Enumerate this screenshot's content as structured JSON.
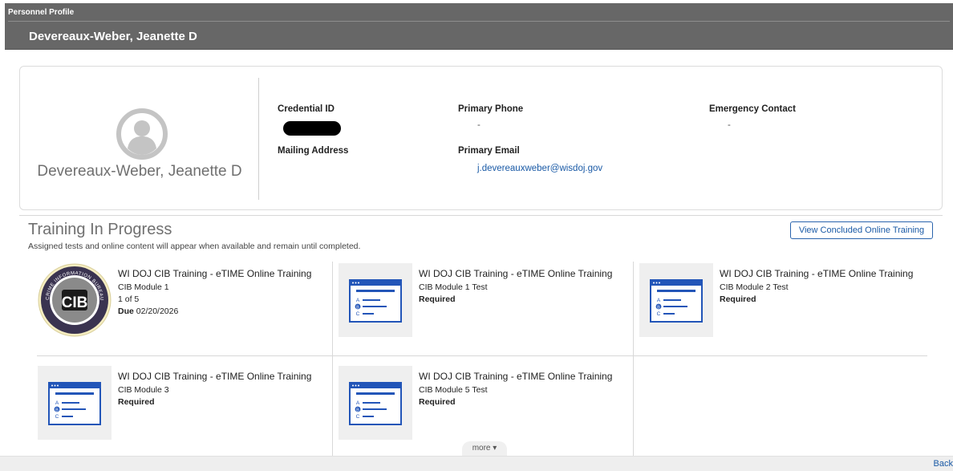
{
  "header": {
    "section_title": "Personnel Profile",
    "person_name": "Devereaux-Weber, Jeanette D"
  },
  "profile": {
    "display_name": "Devereaux-Weber, Jeanette D",
    "credential_id_label": "Credential ID",
    "mailing_address_label": "Mailing Address",
    "primary_phone_label": "Primary Phone",
    "primary_phone_value": "-",
    "primary_email_label": "Primary Email",
    "primary_email_value": "j.devereauxweber@wisdoj.gov",
    "emergency_contact_label": "Emergency Contact",
    "emergency_contact_value": "-"
  },
  "training": {
    "title": "Training In Progress",
    "subtitle": "Assigned tests and online content will appear when available and remain until completed.",
    "view_concluded_label": "View Concluded Online Training",
    "more_label": "more ▾",
    "items": [
      {
        "title": "WI DOJ CIB Training - eTIME Online Training",
        "module": "CIB Module 1",
        "progress": "1 of 5",
        "due_label": "Due",
        "due_date": "02/20/2026",
        "icon": "cib-seal-icon"
      },
      {
        "title": "WI DOJ CIB Training - eTIME Online Training",
        "module": "CIB Module 1 Test",
        "status": "Required",
        "icon": "quiz-window-icon"
      },
      {
        "title": "WI DOJ CIB Training - eTIME Online Training",
        "module": "CIB Module 2 Test",
        "status": "Required",
        "icon": "quiz-window-icon"
      },
      {
        "title": "WI DOJ CIB Training - eTIME Online Training",
        "module": "CIB Module 3",
        "status": "Required",
        "icon": "quiz-window-icon"
      },
      {
        "title": "WI DOJ CIB Training - eTIME Online Training",
        "module": "CIB Module 5 Test",
        "status": "Required",
        "icon": "quiz-window-icon"
      }
    ]
  },
  "seal": {
    "letters": "CIB",
    "ring_text": "CRIME INFORMATION BUREAU"
  },
  "footer": {
    "back_label": "Back"
  },
  "colors": {
    "header_bg": "#676767",
    "link_blue": "#1a5aa6",
    "icon_blue": "#2255b8",
    "thumb_bg": "#efefef"
  }
}
